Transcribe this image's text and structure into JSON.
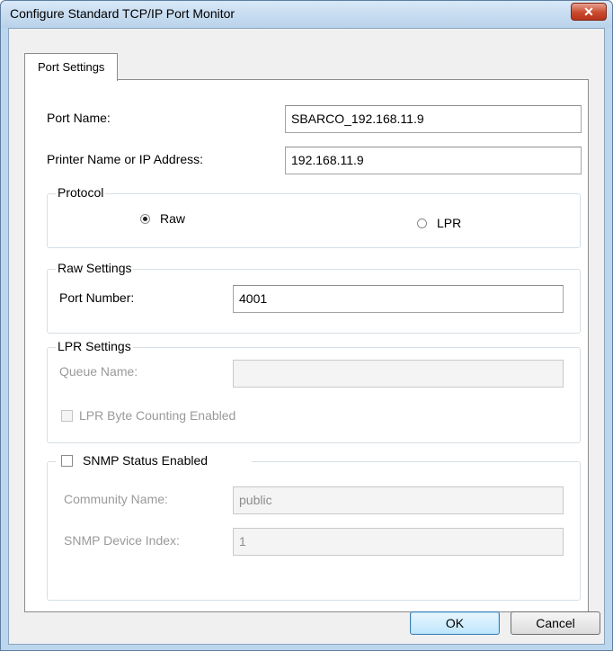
{
  "window": {
    "title": "Configure Standard TCP/IP Port Monitor",
    "close_label": "✕"
  },
  "tabs": [
    {
      "label": "Port Settings",
      "selected": true
    }
  ],
  "port_name": {
    "label": "Port Name:",
    "value": "SBARCO_192.168.11.9"
  },
  "printer_address": {
    "label": "Printer Name or IP Address:",
    "value": "192.168.11.9"
  },
  "protocol": {
    "title": "Protocol",
    "options": [
      {
        "label": "Raw",
        "selected": true
      },
      {
        "label": "LPR",
        "selected": false
      }
    ]
  },
  "raw_settings": {
    "title": "Raw Settings",
    "port_number": {
      "label": "Port Number:",
      "value": "4001"
    }
  },
  "lpr_settings": {
    "title": "LPR Settings",
    "queue_name": {
      "label": "Queue Name:",
      "value": ""
    },
    "byte_counting": {
      "label": "LPR Byte Counting Enabled",
      "checked": false
    }
  },
  "snmp": {
    "title": "SNMP Status Enabled",
    "checked": false,
    "community_name": {
      "label": "Community Name:",
      "value": "public"
    },
    "device_index": {
      "label": "SNMP Device Index:",
      "value": "1"
    }
  },
  "buttons": {
    "ok_label": "OK",
    "cancel_label": "Cancel"
  },
  "colors": {
    "window_frame": "#bcd6ee",
    "close_button": "#c94a2e",
    "default_button": "#bee6fd"
  }
}
